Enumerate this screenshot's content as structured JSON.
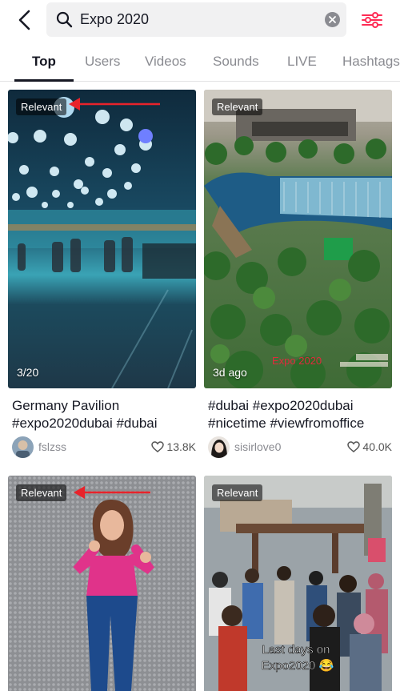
{
  "search": {
    "query": "Expo 2020"
  },
  "tabs": [
    {
      "label": "Top"
    },
    {
      "label": "Users"
    },
    {
      "label": "Videos"
    },
    {
      "label": "Sounds"
    },
    {
      "label": "LIVE"
    },
    {
      "label": "Hashtags"
    }
  ],
  "results": [
    {
      "badge": "Relevant",
      "overlay": "3/20",
      "caption": "Germany Pavilion #expo2020dubai #dubai",
      "username": "fslzss",
      "likes": "13.8K"
    },
    {
      "badge": "Relevant",
      "overlay": "3d ago",
      "watermark": "Expo 2020",
      "caption": "#dubai #expo2020dubai #nicetime #viewfromoffice",
      "username": "sisirlove0",
      "likes": "40.0K"
    },
    {
      "badge": "Relevant"
    },
    {
      "badge": "Relevant",
      "overlay": "Last days on Expo2020 😂"
    }
  ],
  "colors": {
    "accent": "#fe2c55",
    "annotation_arrow": "#e8232b"
  }
}
